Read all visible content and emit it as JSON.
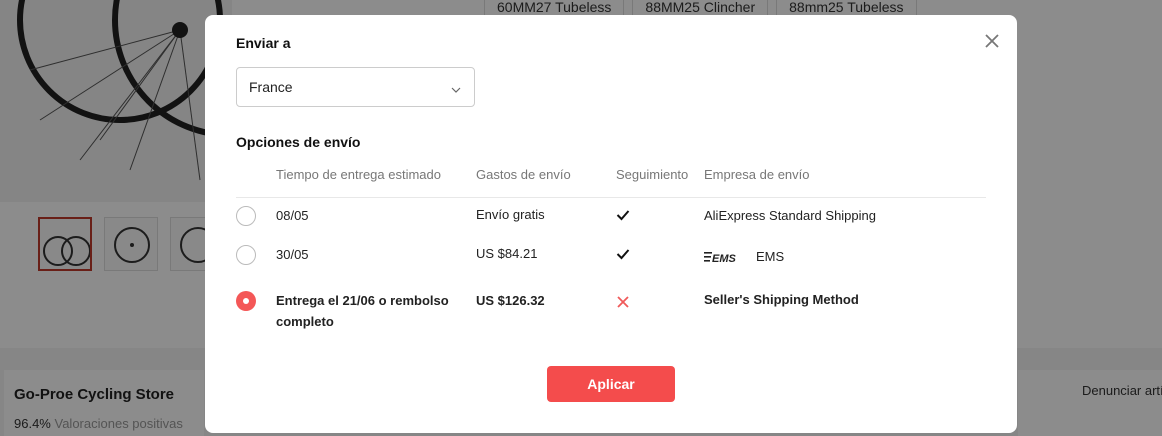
{
  "background": {
    "variants": [
      "60MM27 Tubeless",
      "88MM25 Clincher",
      "88mm25 Tubeless"
    ],
    "store": {
      "name": "Go-Proe Cycling Store",
      "rating_pct": "96.4%",
      "rating_label": "Valoraciones positivas",
      "report_label": "Denunciar artí"
    }
  },
  "modal": {
    "ship_to_label": "Enviar a",
    "country": "France",
    "options_title": "Opciones de envío",
    "columns": [
      "Tiempo de entrega estimado",
      "Gastos de envío",
      "Seguimiento",
      "Empresa de envío"
    ],
    "options": [
      {
        "time": "08/05",
        "cost": "Envío gratis",
        "tracking": true,
        "tracking_icon": "check-icon",
        "company": "AliExpress Standard Shipping",
        "company_logo": "",
        "selected": false
      },
      {
        "time": "30/05",
        "cost": "US $84.21",
        "tracking": true,
        "tracking_icon": "check-icon",
        "company": "EMS",
        "company_logo": "EMS",
        "selected": false
      },
      {
        "time": "Entrega el 21/06 o rembolso completo",
        "cost": "US $126.32",
        "tracking": false,
        "tracking_icon": "cross-icon",
        "company": "Seller's Shipping Method",
        "company_logo": "",
        "selected": true
      }
    ],
    "apply_label": "Aplicar",
    "close_icon": "close-icon"
  },
  "colors": {
    "accent": "#f44c4c",
    "radio_selected": "#f45757",
    "cross": "#f05a5a"
  }
}
